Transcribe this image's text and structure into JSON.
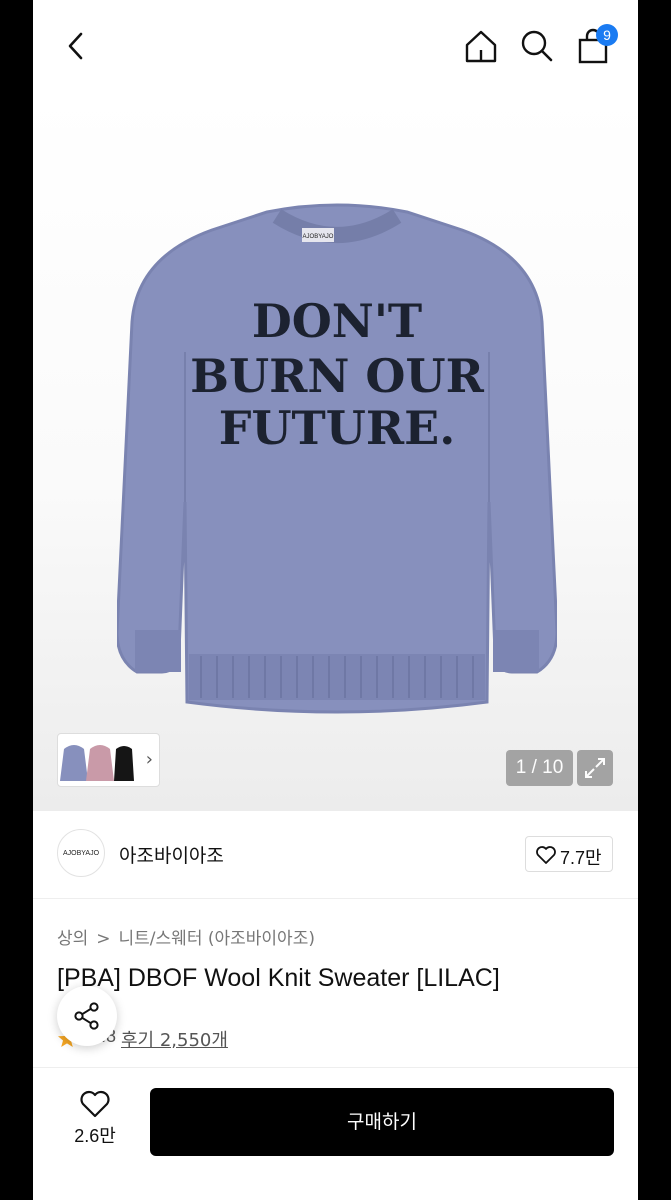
{
  "header": {
    "back_icon": "chevron-left-icon",
    "home_icon": "home-icon",
    "search_icon": "search-icon",
    "cart_icon": "shopping-bag-icon",
    "cart_count": "9",
    "badge_color": "#1a7bf2"
  },
  "gallery": {
    "counter": "1 / 10",
    "thumb_more_icon": "chevron-right-icon",
    "expand_icon": "expand-icon",
    "sweater_color": "#8790bd",
    "print_lines": [
      "DON'T",
      "BURN OUR",
      "FUTURE."
    ],
    "neck_label": "AJOBYAJO"
  },
  "brand": {
    "logo_text": "AJOBYAJO",
    "name": "아조바이아조",
    "like_count": "7.7만"
  },
  "product": {
    "breadcrumb": [
      "상의",
      "니트/스웨터 (아조바이아조)"
    ],
    "breadcrumb_separator": ">",
    "title": "[PBA] DBOF Wool Knit Sweater [LILAC]",
    "rating": "4.8",
    "reviews": "후기 2,550개"
  },
  "bottom": {
    "wish_count": "2.6만",
    "buy_label": "구매하기"
  }
}
